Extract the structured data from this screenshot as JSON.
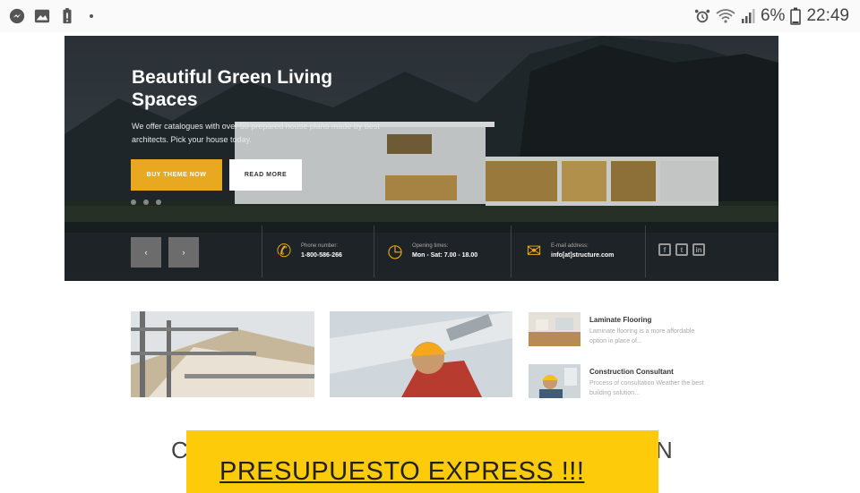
{
  "status_bar": {
    "battery_percent": "6%",
    "time": "22:49",
    "icons": [
      "messenger-icon",
      "gallery-icon",
      "battery-alert-icon",
      "dot-icon",
      "alarm-icon",
      "wifi-icon",
      "signal-icon",
      "battery-icon"
    ]
  },
  "hero": {
    "title": "Beautiful Green Living Spaces",
    "subtitle": "We offer catalogues with over 50 prepared house plans made by best architects. Pick your house today.",
    "buy_button": "BUY THEME NOW",
    "read_button": "READ MORE",
    "prev_arrow": "‹",
    "next_arrow": "›",
    "phone_label": "Phone number:",
    "phone_value": "1-800-586-266",
    "hours_label": "Opening times:",
    "hours_value": "Mon - Sat: 7.00 - 18.00",
    "email_label": "E-mail address:",
    "email_value": "info[at]structure.com",
    "social": [
      "f",
      "t",
      "in"
    ]
  },
  "side_items": [
    {
      "title": "Laminate Flooring",
      "desc": "Laminate flooring is a more affordable option in place of..."
    },
    {
      "title": "Construction Consultant",
      "desc": "Process of consultation Weather the best building solution..."
    }
  ],
  "bottom": {
    "left_letter": "C",
    "right_letter": "N",
    "banner_text": "PRESUPUESTO EXPRESS  !!!"
  },
  "colors": {
    "accent": "#e8a81f",
    "banner": "#fdcb0a"
  }
}
